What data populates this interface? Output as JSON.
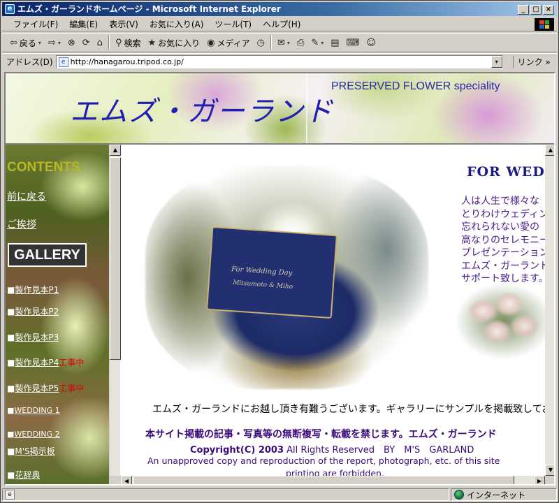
{
  "window": {
    "title": "エムズ・ガーランドホームページ - Microsoft Internet Explorer",
    "title_icon": "e",
    "min": "_",
    "max": "□",
    "close": "×"
  },
  "menubar": {
    "items": [
      "ファイル(F)",
      "編集(E)",
      "表示(V)",
      "お気に入り(A)",
      "ツール(T)",
      "ヘルプ(H)"
    ]
  },
  "toolbar": {
    "back_label": "戻る",
    "back_icon": "⇦",
    "forward_icon": "⇨",
    "stop_icon": "⊗",
    "refresh_icon": "⟳",
    "home_icon": "⌂",
    "search_icon": "⚲",
    "search_label": "検索",
    "favorites_icon": "★",
    "favorites_label": "お気に入り",
    "media_icon": "◉",
    "media_label": "メディア",
    "history_icon": "◷",
    "mail_icon": "✉",
    "print_icon": "⎙",
    "edit_icon": "✎",
    "discuss_icon": "▤",
    "research_icon": "⌨",
    "messenger_icon": "☺",
    "dropdown": "▾"
  },
  "address": {
    "label": "アドレス(D)",
    "url": "http://hanagarou.tripod.co.jp/",
    "dropdown": "▾",
    "page_icon": "e",
    "links_label": "リンク »"
  },
  "header": {
    "subtitle": "PRESERVED FLOWER speciality",
    "title": "エムズ・ガーランド"
  },
  "sidebar": {
    "contents": "CONTENTS",
    "back_link": "前に戻る",
    "greeting_link": "ご挨拶",
    "gallery": "GALLERY",
    "bullet": "■",
    "items": [
      {
        "label": "製作見本P1",
        "wip": ""
      },
      {
        "label": "製作見本P2",
        "wip": ""
      },
      {
        "label": "製作見本P3",
        "wip": ""
      },
      {
        "label": "製作見本P4",
        "wip": "工事中"
      },
      {
        "label": "製作見本P5",
        "wip": "工事中"
      },
      {
        "label": "WEDDING 1",
        "wip": ""
      },
      {
        "label": "WEDDING 2",
        "wip": ""
      },
      {
        "label": "M'S掲示板",
        "wip": ""
      },
      {
        "label": "花辞典",
        "wip": ""
      }
    ],
    "scroll_up": "▲"
  },
  "main": {
    "for_wedding": "FOR WED",
    "intro_lines": [
      "人は人生で様々な",
      "とりわけウェディン",
      "忘れられない愛の",
      "高なりのセレモニー",
      "プレゼンテーション",
      "エムズ・ガーランド",
      "サポート致します。"
    ],
    "sign_line1": "For Wedding Day",
    "sign_line2": "Mitsumoto & Miho",
    "welcome": "エムズ・ガーランドにお越し頂き有難うございます。ギャラリーにサンプルを掲載致しております",
    "notice": "本サイト掲載の記事・写真等の無断複写・転載を禁じます。エムズ・ガーランド",
    "copyright_bold": "Copyright(C) 2003",
    "copyright_rest": " All Rights Reserved　BY　M'S　GARLAND",
    "english_line1": "An unapproved copy and reproduction of the report, photograph, etc. of this site",
    "english_line2": "printing are forbidden."
  },
  "scrollbars": {
    "up": "▲",
    "down": "▼",
    "left": "◀",
    "right": "▶"
  },
  "statusbar": {
    "page_icon": "e",
    "zone": "インターネット"
  }
}
